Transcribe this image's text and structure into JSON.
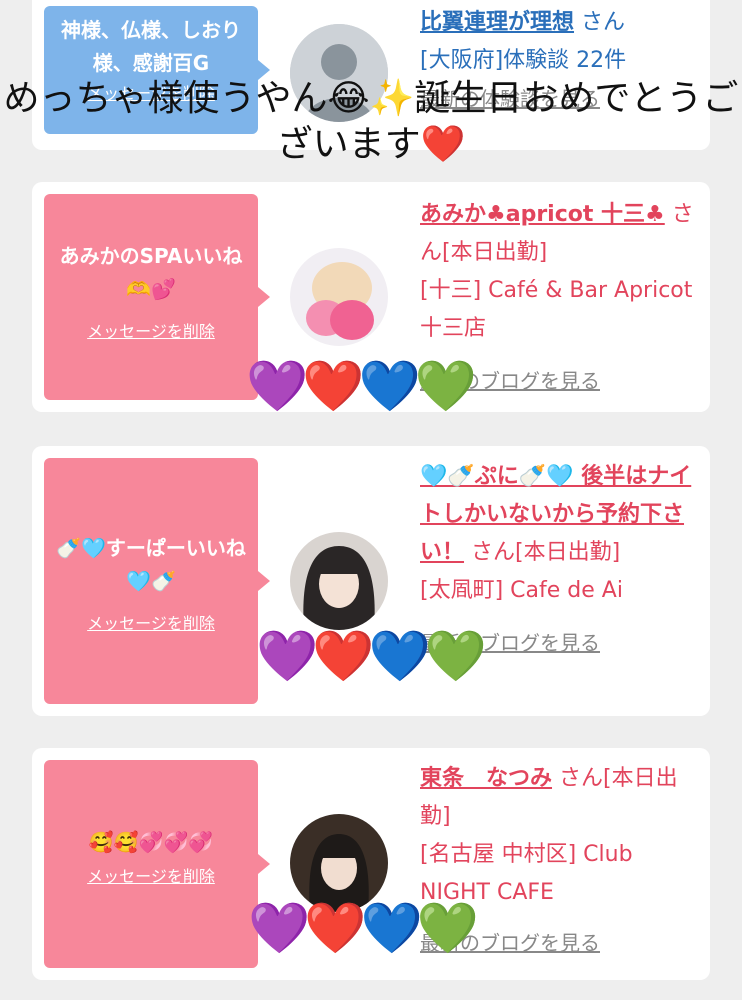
{
  "cards": [
    {
      "message": "神様、仏様、しおり様、感謝百G",
      "delete_label": "メッセージを削除",
      "name": "比翼連理が理想",
      "honorific": "さん",
      "detail": "[大阪府]体験談 22件",
      "link_label": "最新の体験談を見る",
      "accent": "#7eb4ea"
    },
    {
      "message": "あみかのSPAいいね🫶💕",
      "delete_label": "メッセージを削除",
      "name": "あみか♣apricot 十三♣",
      "honorific": "さん[本日出勤]",
      "detail": "[十三] Café & Bar Apricot 十三店",
      "link_label": "最新のブログを見る",
      "accent": "#f7879a"
    },
    {
      "message": "🍼🩵すーぱーいいね🩵🍼",
      "delete_label": "メッセージを削除",
      "name": "🩵🍼ぷに🍼🩵 後半はナイトしかいないから予約下さい！",
      "honorific": "さん[本日出勤]",
      "detail": "[太凮町] Cafe de Ai",
      "link_label": "最新のブログを見る",
      "accent": "#f7879a"
    },
    {
      "message": "🥰🥰💞💞💞",
      "delete_label": "メッセージを削除",
      "name": "東条　なつみ",
      "honorific": "さん[本日出勤]",
      "detail": "[名古屋 中村区] Club NIGHT CAFE",
      "link_label": "最新のブログを見る",
      "accent": "#f7879a"
    }
  ],
  "hearts": "💜❤️💙💚",
  "caption": "めっちゃ様使うやん😂✨誕生日おめでとうございます❤️"
}
